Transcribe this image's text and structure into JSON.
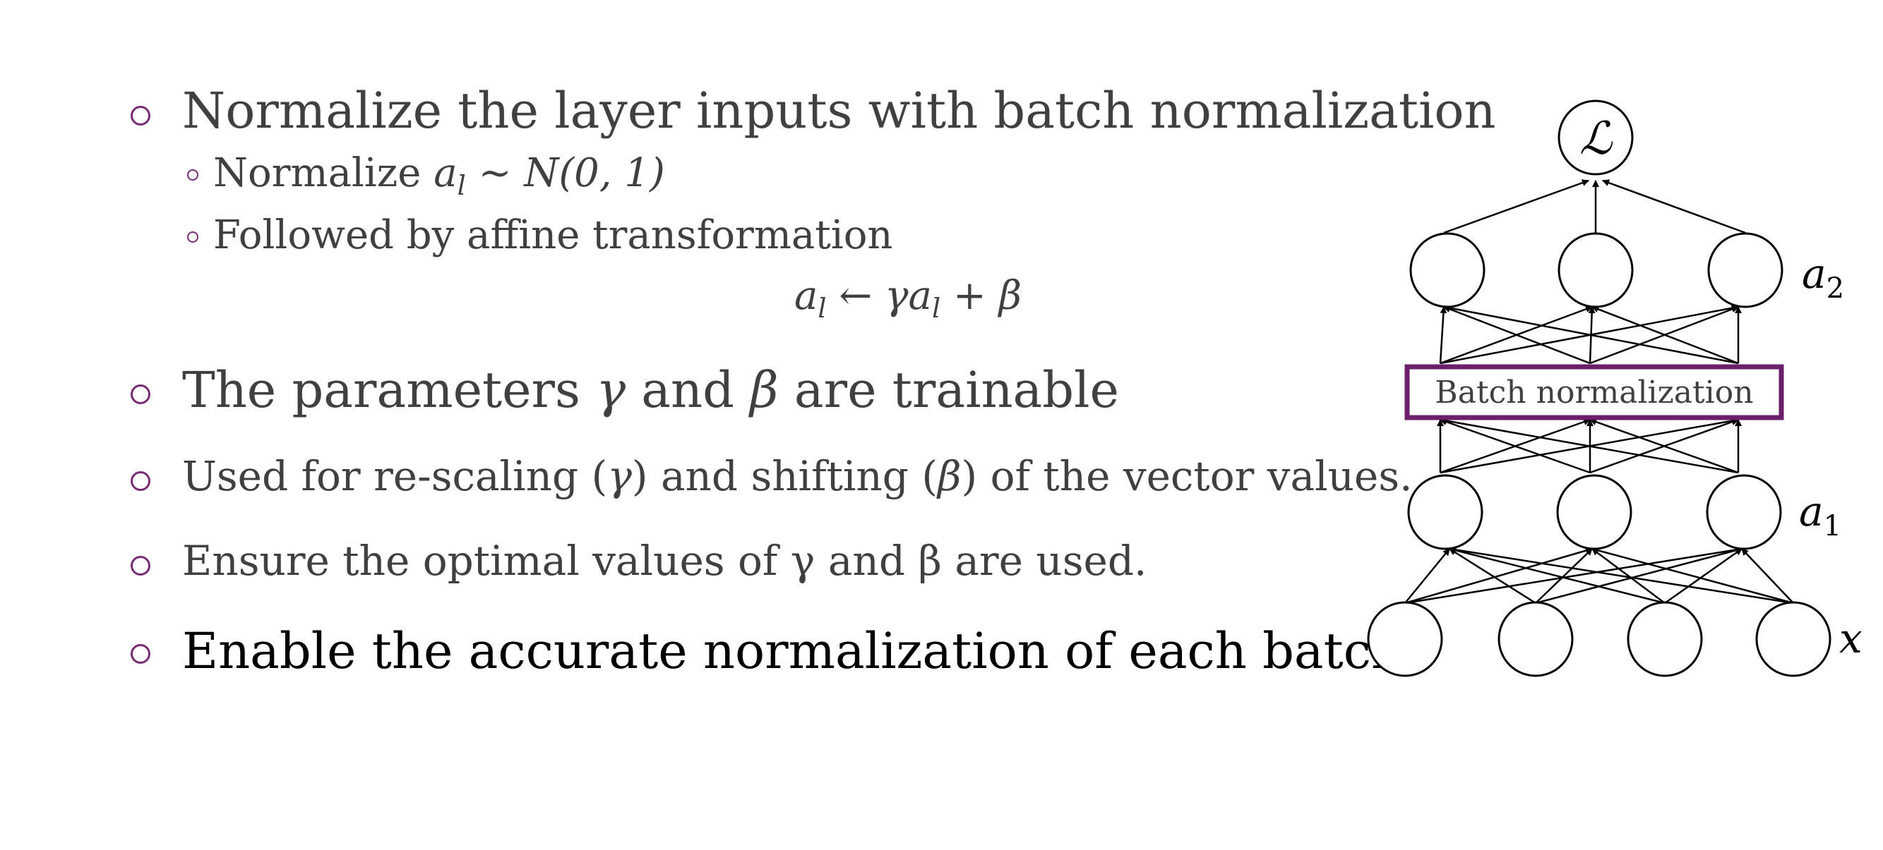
{
  "bullets": [
    {
      "text": "Normalize the layer inputs with batch normalization"
    },
    {
      "text_pre": "The parameters ",
      "gamma": "γ",
      "mid": " and ",
      "beta": "β",
      "post": " are trainable"
    },
    {
      "text_pre": "Used for re-scaling (",
      "gamma": "γ",
      "mid": ") and shifting (",
      "beta": "β",
      "post": ") of the vector values."
    },
    {
      "text": "Ensure the optimal values of γ and β are used."
    },
    {
      "text": "Enable the accurate normalization of each batch."
    }
  ],
  "sub_bullets": [
    {
      "text_pre": "Normalize ",
      "math": "a",
      "sub": "l",
      "rest": " ~ N(0, 1)"
    },
    {
      "text": "Followed by affine transformation"
    }
  ],
  "equation": {
    "lhs": "a",
    "lhs_sub": "l",
    "arrow": " ← ",
    "rhs_a": "γa",
    "rhs_sub": "l",
    "rhs_rest": " + β"
  },
  "diagram": {
    "loss_symbol": "ℒ",
    "bn_label": "Batch normalization",
    "label_a2": "a",
    "label_a2_sub": "2",
    "label_a1": "a",
    "label_a1_sub": "1",
    "label_x": "x",
    "box_color": "#6b1f6b"
  }
}
